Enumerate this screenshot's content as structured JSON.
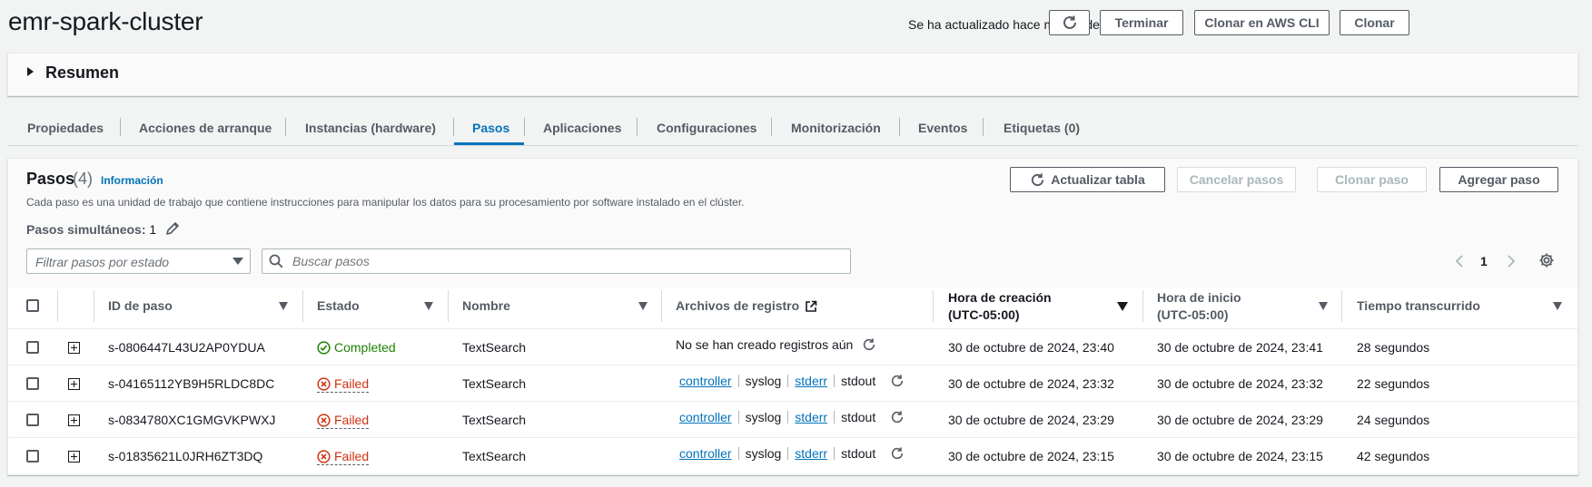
{
  "header": {
    "title": "emr-spark-cluster",
    "updated_text": "Se ha actualizado hace menos de un minuto",
    "terminate_label": "Terminar",
    "clone_cli_label": "Clonar en AWS CLI",
    "clone_label": "Clonar"
  },
  "summary": {
    "label": "Resumen"
  },
  "tabs": [
    {
      "label": "Propiedades"
    },
    {
      "label": "Acciones de arranque"
    },
    {
      "label": "Instancias (hardware)"
    },
    {
      "label": "Pasos",
      "active": true
    },
    {
      "label": "Aplicaciones"
    },
    {
      "label": "Configuraciones"
    },
    {
      "label": "Monitorización"
    },
    {
      "label": "Eventos"
    },
    {
      "label": "Etiquetas (0)"
    }
  ],
  "steps": {
    "title": "Pasos",
    "count": "(4)",
    "info_label": "Información",
    "description": "Cada paso es una unidad de trabajo que contiene instrucciones para manipular los datos para su procesamiento por software instalado en el clúster.",
    "concurrent_label": "Pasos simultáneos:",
    "concurrent_value": "1",
    "refresh_label": "Actualizar tabla",
    "cancel_label": "Cancelar pasos",
    "clone_step_label": "Clonar paso",
    "add_step_label": "Agregar paso",
    "filter_placeholder": "Filtrar pasos por estado",
    "search_placeholder": "Buscar pasos",
    "page": "1"
  },
  "table": {
    "columns": {
      "id": "ID de paso",
      "state": "Estado",
      "name": "Nombre",
      "logs": "Archivos de registro",
      "created_l1": "Hora de creación",
      "created_l2": "(UTC-05:00)",
      "started_l1": "Hora de inicio",
      "started_l2": "(UTC-05:00)",
      "elapsed": "Tiempo transcurrido"
    },
    "no_logs_text": "No se han creado registros aún",
    "log_labels": {
      "controller": "controller",
      "syslog": "syslog",
      "stderr": "stderr",
      "stdout": "stdout"
    },
    "rows": [
      {
        "id": "s-0806447L43U2AP0YDUA",
        "state": "Completed",
        "status": "ok",
        "name": "TextSearch",
        "has_logs": false,
        "created": "30 de octubre de 2024, 23:40",
        "started": "30 de octubre de 2024, 23:41",
        "elapsed": "28 segundos"
      },
      {
        "id": "s-04165112YB9H5RLDC8DC",
        "state": "Failed",
        "status": "fail",
        "name": "TextSearch",
        "has_logs": true,
        "created": "30 de octubre de 2024, 23:32",
        "started": "30 de octubre de 2024, 23:32",
        "elapsed": "22 segundos"
      },
      {
        "id": "s-0834780XC1GMGVKPWXJ",
        "state": "Failed",
        "status": "fail",
        "name": "TextSearch",
        "has_logs": true,
        "created": "30 de octubre de 2024, 23:29",
        "started": "30 de octubre de 2024, 23:29",
        "elapsed": "24 segundos"
      },
      {
        "id": "s-01835621L0JRH6ZT3DQ",
        "state": "Failed",
        "status": "fail",
        "name": "TextSearch",
        "has_logs": true,
        "created": "30 de octubre de 2024, 23:15",
        "started": "30 de octubre de 2024, 23:15",
        "elapsed": "42 segundos"
      }
    ]
  },
  "colors": {
    "accent": "#0073bb",
    "success": "#1d8102",
    "error": "#d13212"
  }
}
